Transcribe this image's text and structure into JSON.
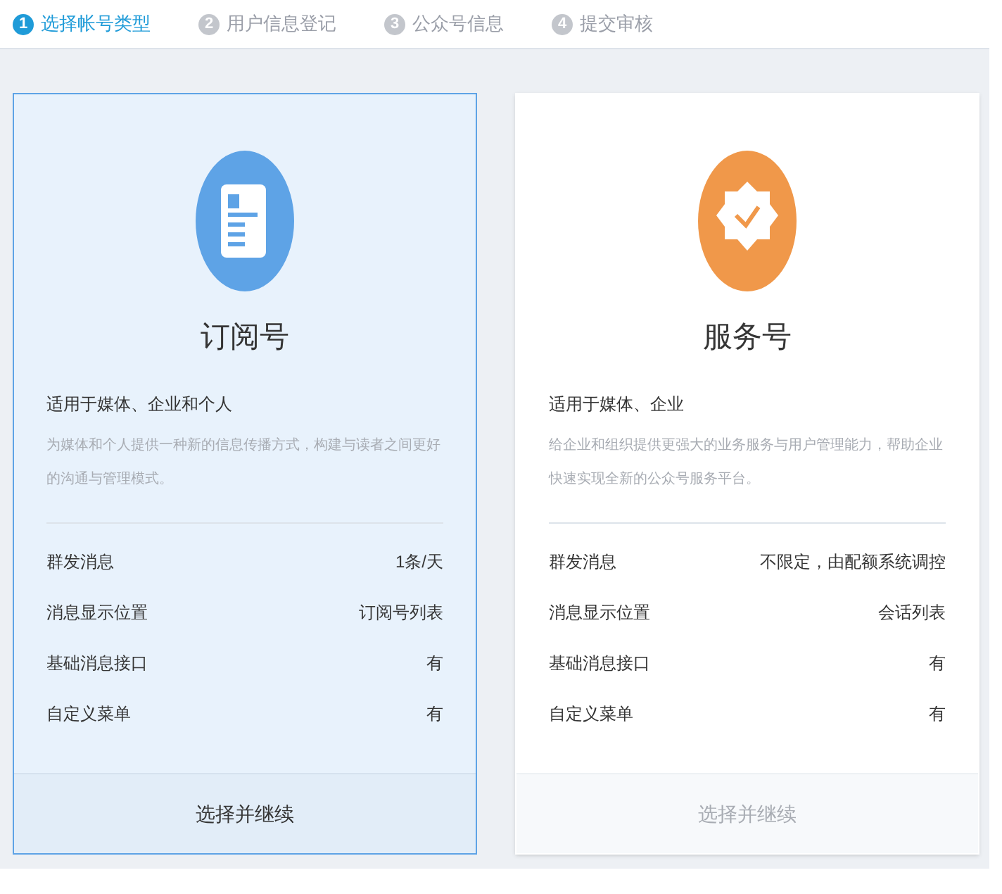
{
  "steps": [
    {
      "number": "1",
      "label": "选择帐号类型",
      "selected": true
    },
    {
      "number": "2",
      "label": "用户信息登记",
      "selected": false
    },
    {
      "number": "3",
      "label": "公众号信息",
      "selected": false
    },
    {
      "number": "4",
      "label": "提交审核",
      "selected": false
    }
  ],
  "cards": [
    {
      "kind": "document",
      "color": "#5ea3e6",
      "title": "订阅号",
      "audience": "适用于媒体、企业和个人",
      "description": "为媒体和个人提供一种新的信息传播方式，构建与读者之间更好的沟通与管理模式。",
      "selected": true,
      "features": [
        {
          "name": "群发消息",
          "value": "1条/天"
        },
        {
          "name": "消息显示位置",
          "value": "订阅号列表"
        },
        {
          "name": "基础消息接口",
          "value": "有"
        },
        {
          "name": "自定义菜单",
          "value": "有"
        }
      ],
      "action": "选择并继续"
    },
    {
      "kind": "badge",
      "color": "#f0984a",
      "title": "服务号",
      "audience": "适用于媒体、企业",
      "description": "给企业和组织提供更强大的业务服务与用户管理能力，帮助企业快速实现全新的公众号服务平台。",
      "selected": false,
      "features": [
        {
          "name": "群发消息",
          "value": "不限定，由配额系统调控"
        },
        {
          "name": "消息显示位置",
          "value": "会话列表"
        },
        {
          "name": "基础消息接口",
          "value": "有"
        },
        {
          "name": "自定义菜单",
          "value": "有"
        }
      ],
      "action": "选择并继续"
    }
  ]
}
